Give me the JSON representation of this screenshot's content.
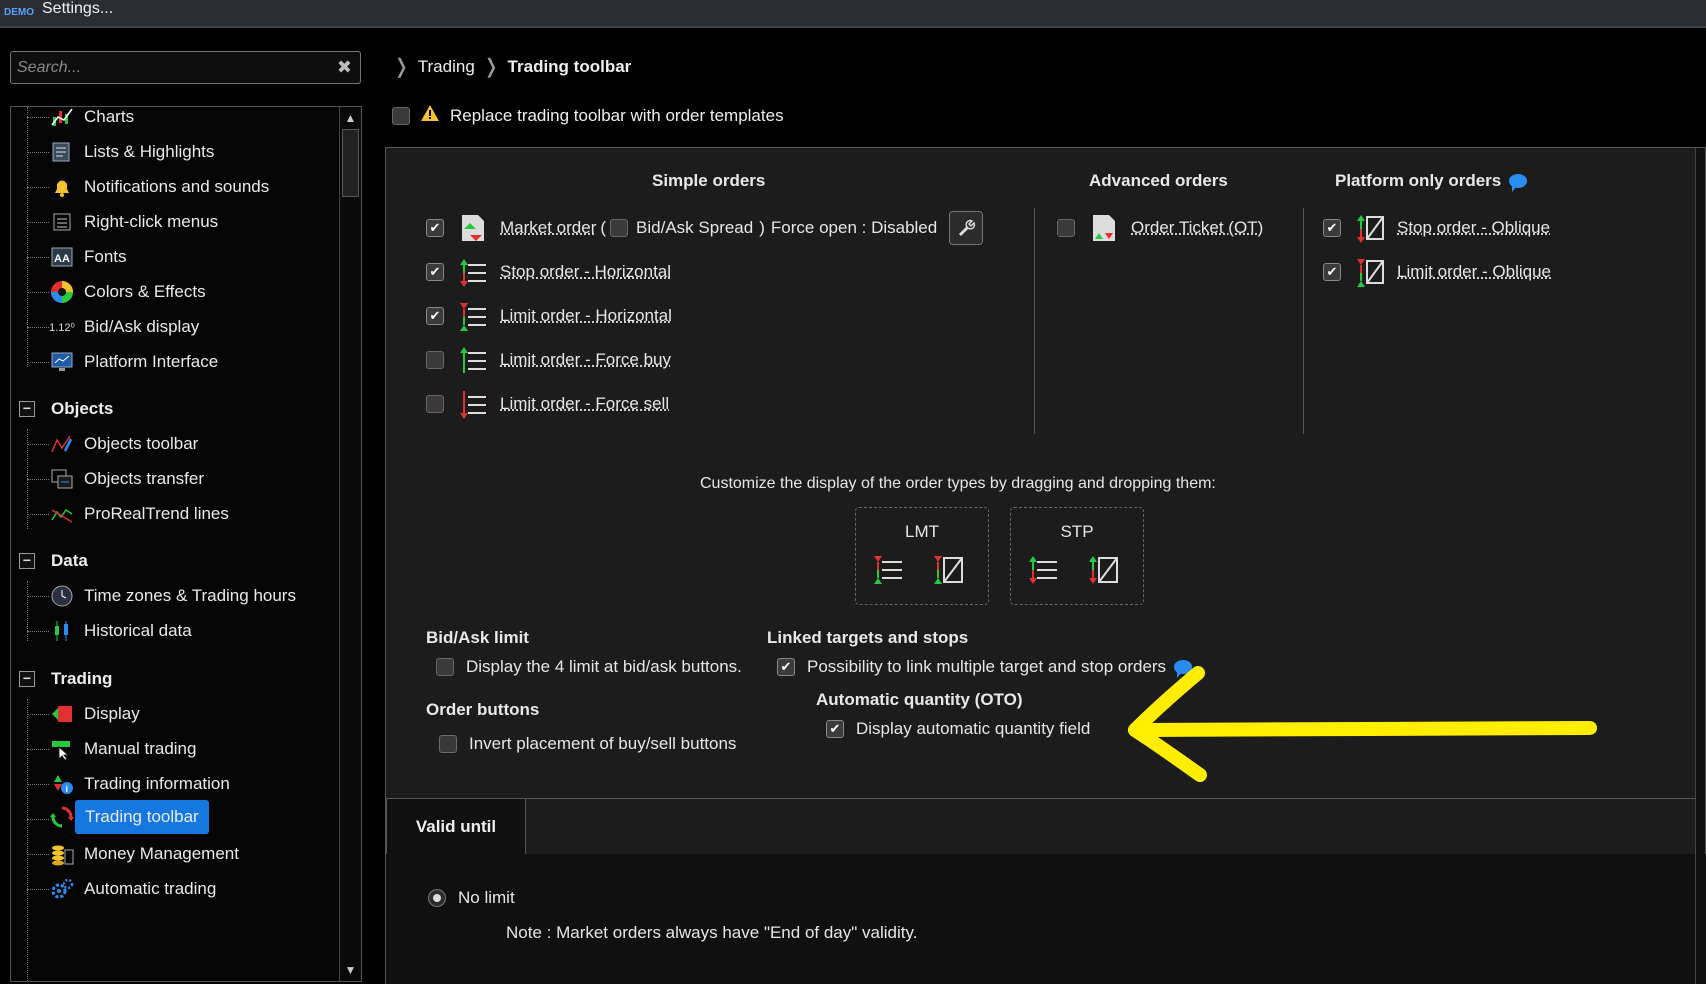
{
  "window": {
    "logo": "DEMO",
    "title": "Settings..."
  },
  "search": {
    "placeholder": "Search...",
    "clear_icon": "close-icon"
  },
  "tree": {
    "platform_items": [
      {
        "label": "Charts",
        "icon": "charts-icon"
      },
      {
        "label": "Lists & Highlights",
        "icon": "lists-icon"
      },
      {
        "label": "Notifications and sounds",
        "icon": "bell-icon"
      },
      {
        "label": "Right-click menus",
        "icon": "menu-icon"
      },
      {
        "label": "Fonts",
        "icon": "fonts-icon"
      },
      {
        "label": "Colors & Effects",
        "icon": "color-wheel-icon"
      },
      {
        "label": "Bid/Ask display",
        "icon": "bidask-icon",
        "icon_text": "1.12⁰"
      },
      {
        "label": "Platform Interface",
        "icon": "monitor-icon"
      }
    ],
    "objects": {
      "label": "Objects",
      "items": [
        {
          "label": "Objects toolbar",
          "icon": "pen-icon"
        },
        {
          "label": "Objects transfer",
          "icon": "transfer-icon"
        },
        {
          "label": "ProRealTrend lines",
          "icon": "trend-icon"
        }
      ]
    },
    "data": {
      "label": "Data",
      "items": [
        {
          "label": "Time zones & Trading hours",
          "icon": "clock-icon"
        },
        {
          "label": "Historical data",
          "icon": "candles-icon"
        }
      ]
    },
    "trading": {
      "label": "Trading",
      "items": [
        {
          "label": "Display",
          "icon": "display-icon"
        },
        {
          "label": "Manual trading",
          "icon": "hand-icon"
        },
        {
          "label": "Trading information",
          "icon": "info-icon"
        },
        {
          "label": "Trading toolbar",
          "icon": "toolbar-icon",
          "selected": true
        },
        {
          "label": "Money Management",
          "icon": "coins-icon"
        },
        {
          "label": "Automatic trading",
          "icon": "gears-icon"
        }
      ]
    }
  },
  "breadcrumb": {
    "parent": "Trading",
    "current": "Trading toolbar"
  },
  "replace_toolbar": {
    "label": "Replace trading toolbar with order templates",
    "checked": false
  },
  "columns": {
    "simple": "Simple orders",
    "advanced": "Advanced orders",
    "platform": "Platform only orders"
  },
  "simple_orders": [
    {
      "label": "Market order",
      "checked": true
    },
    {
      "label": "Stop order - Horizontal",
      "checked": true
    },
    {
      "label": "Limit order - Horizontal",
      "checked": true
    },
    {
      "label": "Limit order - Force buy",
      "checked": false
    },
    {
      "label": "Limit order - Force sell",
      "checked": false
    }
  ],
  "market_extra": {
    "paren_open": "(",
    "spread_label": "Bid/Ask Spread",
    "paren_close": ")",
    "force_open": "Force open : Disabled"
  },
  "advanced_orders": [
    {
      "label": "Order Ticket (OT)",
      "checked": false
    }
  ],
  "platform_orders": [
    {
      "label": "Stop order - Oblique",
      "checked": true
    },
    {
      "label": "Limit order - Oblique",
      "checked": true
    }
  ],
  "customize": {
    "text": "Customize the display of the order types by dragging and dropping them:",
    "boxes": [
      "LMT",
      "STP"
    ]
  },
  "bid_ask_limit": {
    "title": "Bid/Ask limit",
    "option": "Display the 4 limit at bid/ask buttons.",
    "checked": false
  },
  "order_buttons": {
    "title": "Order buttons",
    "option": "Invert placement of buy/sell buttons",
    "checked": false
  },
  "linked": {
    "title": "Linked targets and stops",
    "option": "Possibility to link multiple target and stop orders",
    "checked": true
  },
  "auto_qty": {
    "title": "Automatic quantity (OTO)",
    "option": "Display automatic quantity field",
    "checked": true
  },
  "valid_until": {
    "tab": "Valid until",
    "radio": "No limit",
    "note": "Note : Market orders always have \"End of day\" validity."
  },
  "colors": {
    "selection": "#1478e0",
    "annotation": "#ffee00",
    "up": "#27c93f",
    "down": "#e03030"
  }
}
